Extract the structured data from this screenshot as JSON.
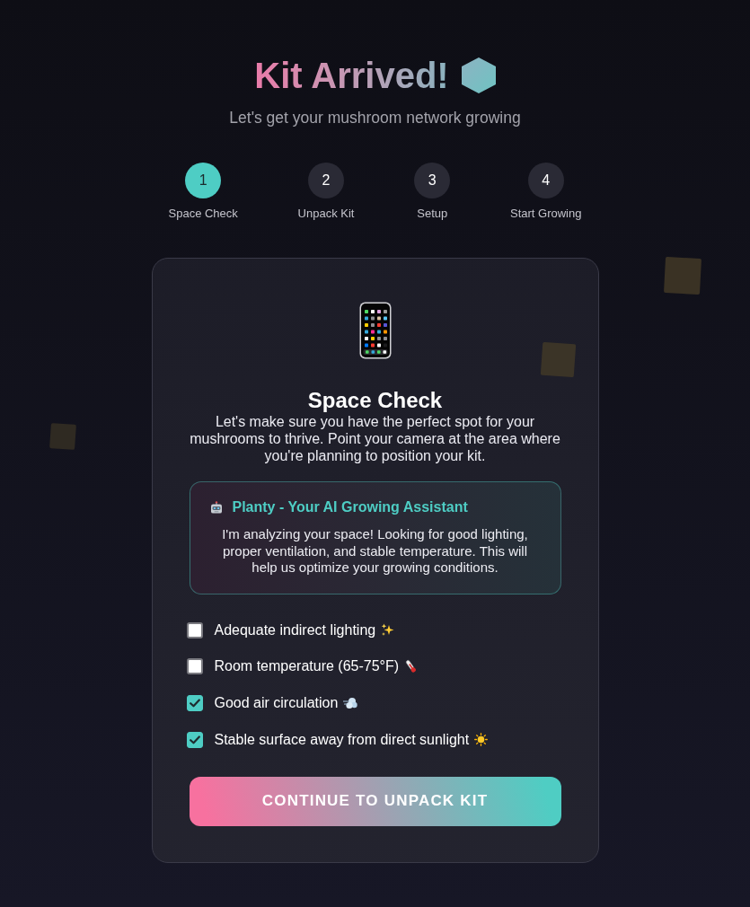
{
  "header": {
    "title": "Kit Arrived!",
    "subtitle": "Let's get your mushroom network growing"
  },
  "steps": [
    {
      "number": "1",
      "label": "Space Check",
      "selected": true
    },
    {
      "number": "2",
      "label": "Unpack Kit",
      "selected": false
    },
    {
      "number": "3",
      "label": "Setup",
      "selected": false
    },
    {
      "number": "4",
      "label": "Start Growing",
      "selected": false
    }
  ],
  "card": {
    "title": "Space Check",
    "description": "Let's make sure you have the perfect spot for your mushrooms to thrive. Point your camera at the area where you're planning to position your kit.",
    "assistant": {
      "title": "Planty - Your AI Growing Assistant",
      "message": "I'm analyzing your space! Looking for good lighting, proper ventilation, and stable temperature. This will help us optimize your growing conditions."
    },
    "checklist": [
      {
        "label": "Adequate indirect lighting",
        "checked": false
      },
      {
        "label": "Room temperature (65-75°F)",
        "checked": false
      },
      {
        "label": "Good air circulation",
        "checked": true
      },
      {
        "label": "Stable surface away from direct sunlight",
        "checked": true
      }
    ],
    "button": "CONTINUE TO UNPACK KIT"
  }
}
